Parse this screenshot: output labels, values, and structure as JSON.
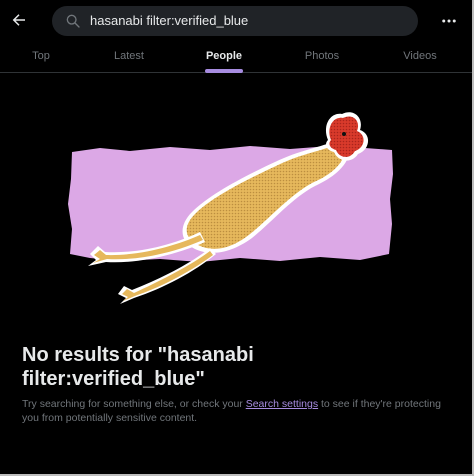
{
  "search": {
    "query": "hasanabi filter:verified_blue"
  },
  "tabs": [
    {
      "label": "Top"
    },
    {
      "label": "Latest"
    },
    {
      "label": "People"
    },
    {
      "label": "Photos"
    },
    {
      "label": "Videos"
    }
  ],
  "active_tab": "People",
  "empty_state": {
    "title": "No results for \"hasanabi filter:verified_blue\"",
    "message_before": "Try searching for something else, or check your ",
    "link_text": "Search settings",
    "message_after": " to see if they're protecting you from potentially sensitive content."
  },
  "icons": {
    "back": "arrow-left-icon",
    "search": "search-icon",
    "more": "more-horizontal-icon"
  },
  "colors": {
    "background": "#000000",
    "accent": "#a78ce0",
    "muted_text": "#71767b",
    "primary_text": "#e7e9ea",
    "illustration_band": "#dca8e6"
  }
}
